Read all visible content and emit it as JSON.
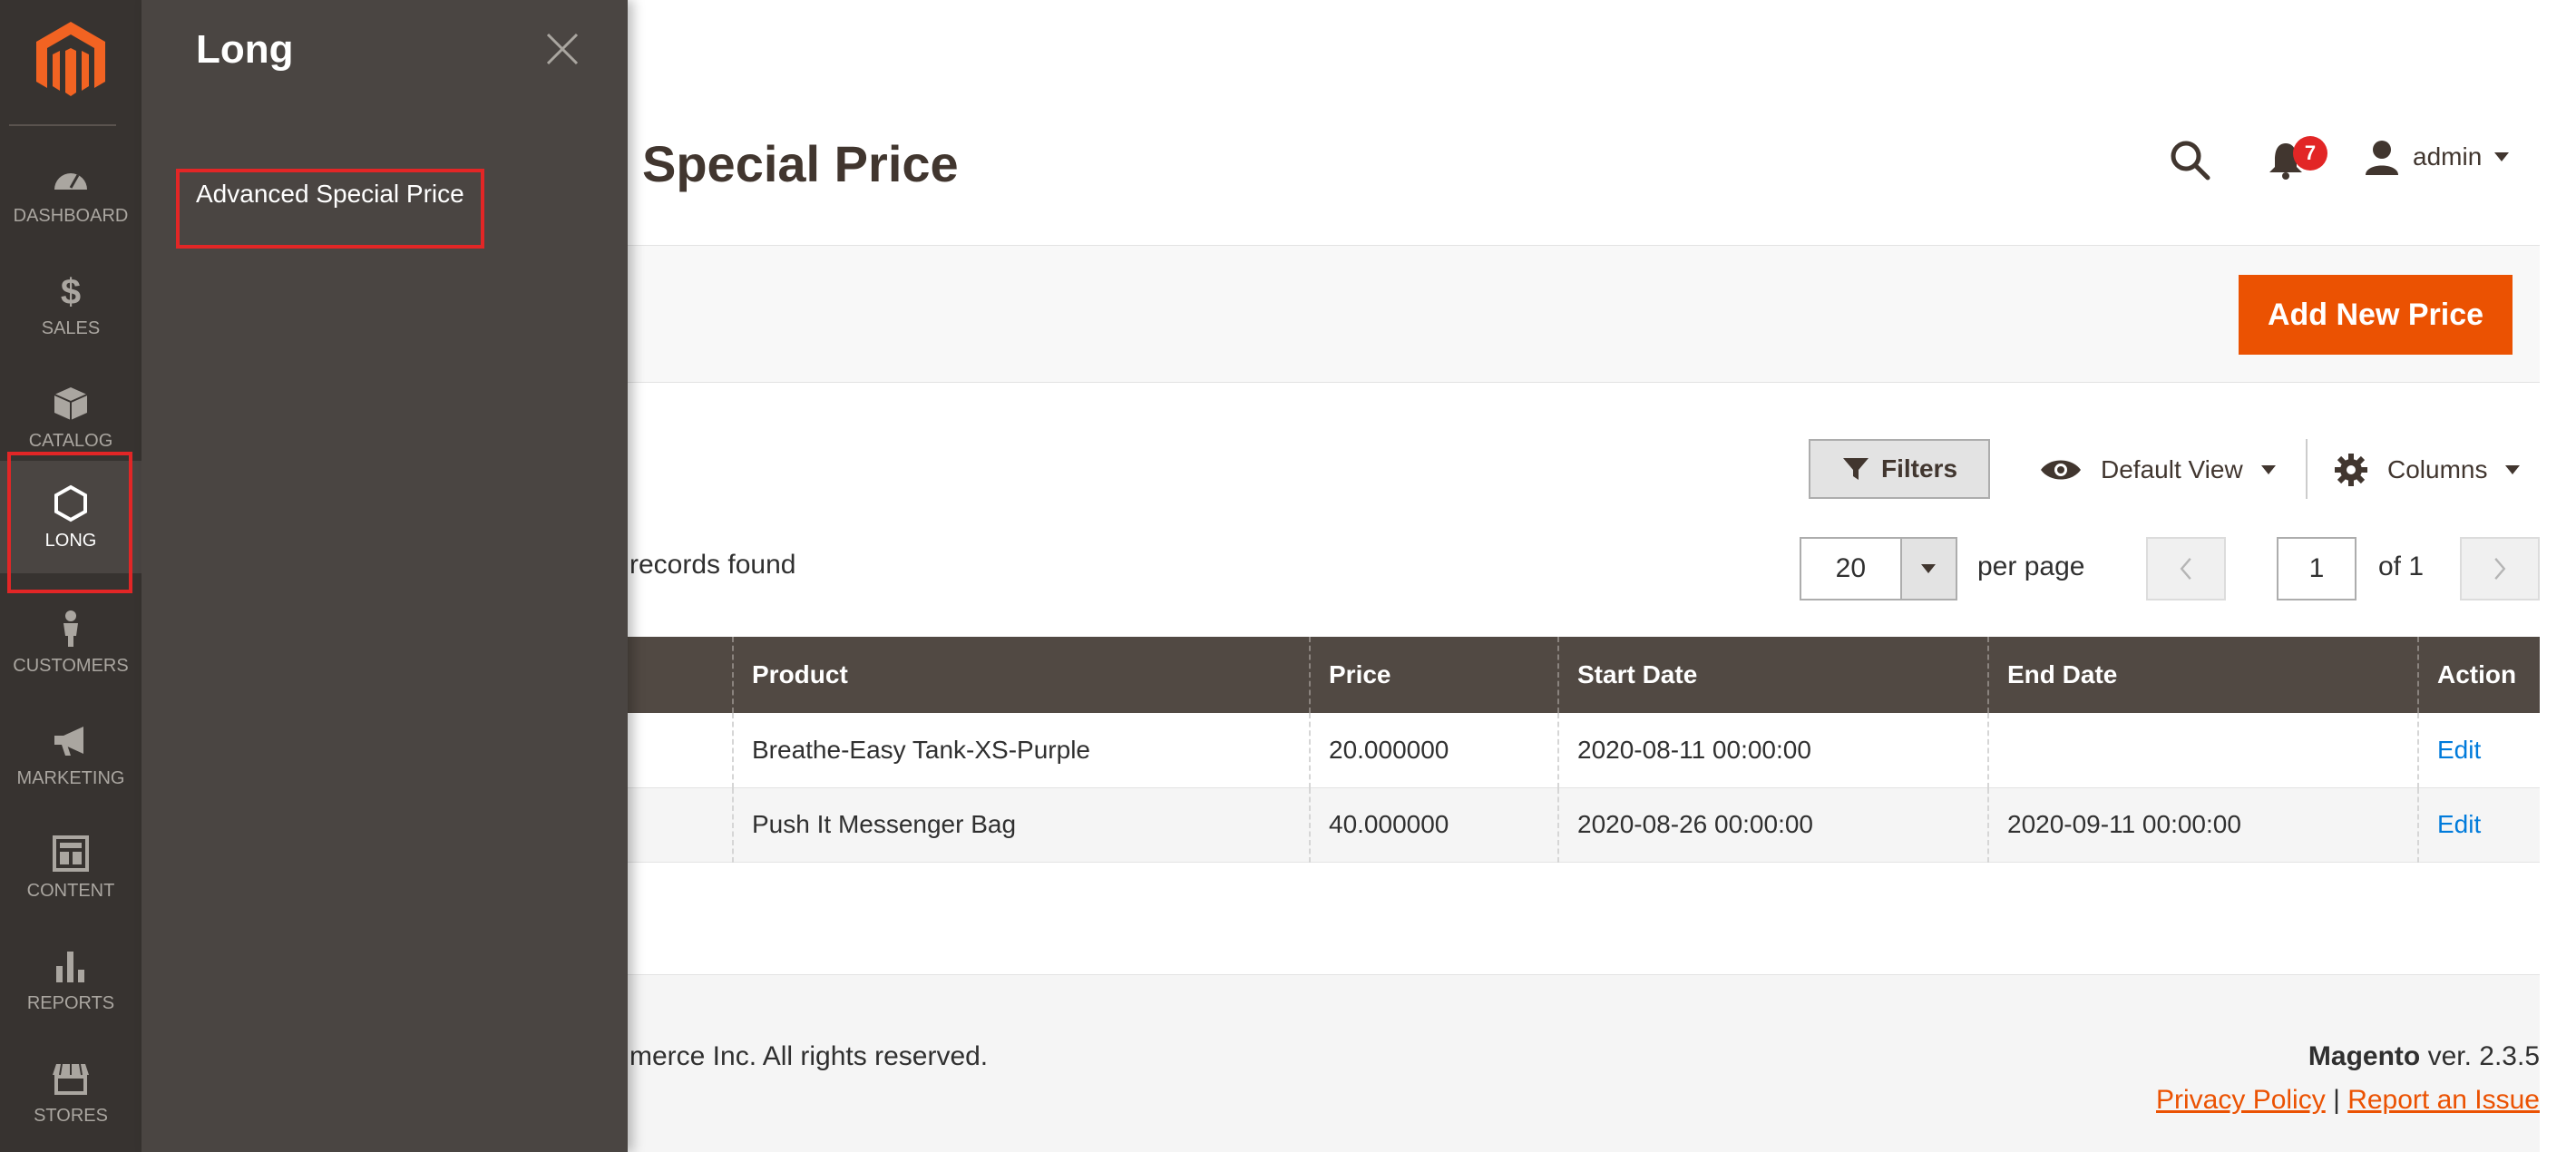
{
  "nav": {
    "items": [
      {
        "label": "DASHBOARD",
        "icon": "dashboard-icon"
      },
      {
        "label": "SALES",
        "icon": "dollar-icon"
      },
      {
        "label": "CATALOG",
        "icon": "catalog-box-icon"
      },
      {
        "label": "LONG",
        "icon": "hexagon-icon"
      },
      {
        "label": "CUSTOMERS",
        "icon": "person-icon"
      },
      {
        "label": "MARKETING",
        "icon": "megaphone-icon"
      },
      {
        "label": "CONTENT",
        "icon": "layout-icon"
      },
      {
        "label": "REPORTS",
        "icon": "bar-chart-icon"
      },
      {
        "label": "STORES",
        "icon": "store-icon"
      }
    ]
  },
  "flyout": {
    "title": "Long",
    "link": "Advanced Special Price"
  },
  "header": {
    "title": "Special Price",
    "notifications_count": "7",
    "user": "admin"
  },
  "actions": {
    "add_new": "Add New Price"
  },
  "toolbar": {
    "filters": "Filters",
    "view": "Default View",
    "columns": "Columns",
    "records": "records found",
    "per_page_value": "20",
    "per_page_label": "per page",
    "page": "1",
    "of": "of 1"
  },
  "grid": {
    "headers": [
      "Product",
      "Price",
      "Start Date",
      "End Date",
      "Action"
    ],
    "rows": [
      [
        "Breathe-Easy Tank-XS-Purple",
        "20.000000",
        "2020-08-11 00:00:00",
        "",
        "Edit"
      ],
      [
        "Push It Messenger Bag",
        "40.000000",
        "2020-08-26 00:00:00",
        "2020-09-11 00:00:00",
        "Edit"
      ]
    ]
  },
  "footer": {
    "copyright": "merce Inc. All rights reserved.",
    "brand": "Magento",
    "version": " ver. 2.3.5",
    "privacy": "Privacy Policy",
    "separator": " | ",
    "report": "Report an Issue"
  },
  "colors": {
    "accent": "#eb5202",
    "nav_bg": "#373330",
    "flyout_bg": "#4a4542",
    "grid_header": "#514943",
    "highlight": "#e22626",
    "link": "#007bdb"
  }
}
